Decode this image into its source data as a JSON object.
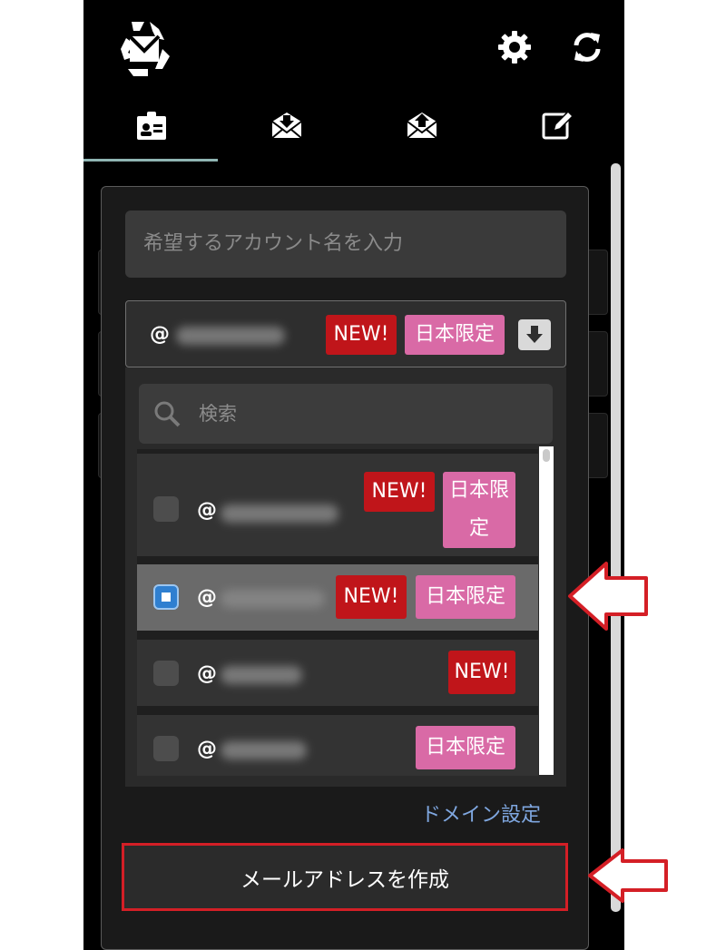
{
  "header": {
    "logo_icon": "recycled-mail-logo",
    "settings_icon": "gear-icon",
    "refresh_icon": "refresh-icon"
  },
  "tabs": [
    {
      "icon": "account-card-icon",
      "active": true
    },
    {
      "icon": "inbox-download-icon",
      "active": false
    },
    {
      "icon": "outbox-upload-icon",
      "active": false
    },
    {
      "icon": "compose-edit-icon",
      "active": false
    }
  ],
  "form": {
    "account_placeholder": "希望するアカウント名を入力",
    "domain_select": {
      "prefix": "@",
      "badge_new": "NEW!",
      "badge_japan": "日本限定"
    },
    "search_placeholder": "検索",
    "options": [
      {
        "prefix": "@",
        "badge_new": "NEW!",
        "badge_japan": "日本限定",
        "checked": false
      },
      {
        "prefix": "@",
        "badge_new": "NEW!",
        "badge_japan": "日本限定",
        "checked": true
      },
      {
        "prefix": "@",
        "badge_new": "NEW!",
        "checked": false
      },
      {
        "prefix": "@",
        "badge_japan": "日本限定",
        "checked": false
      }
    ],
    "domain_settings_link": "ドメイン設定",
    "create_button": "メールアドレスを作成"
  },
  "colors": {
    "badge_new": "#c0151a",
    "badge_japan": "#d96aa6",
    "highlight": "#d41f26",
    "link": "#7fa7e0"
  }
}
